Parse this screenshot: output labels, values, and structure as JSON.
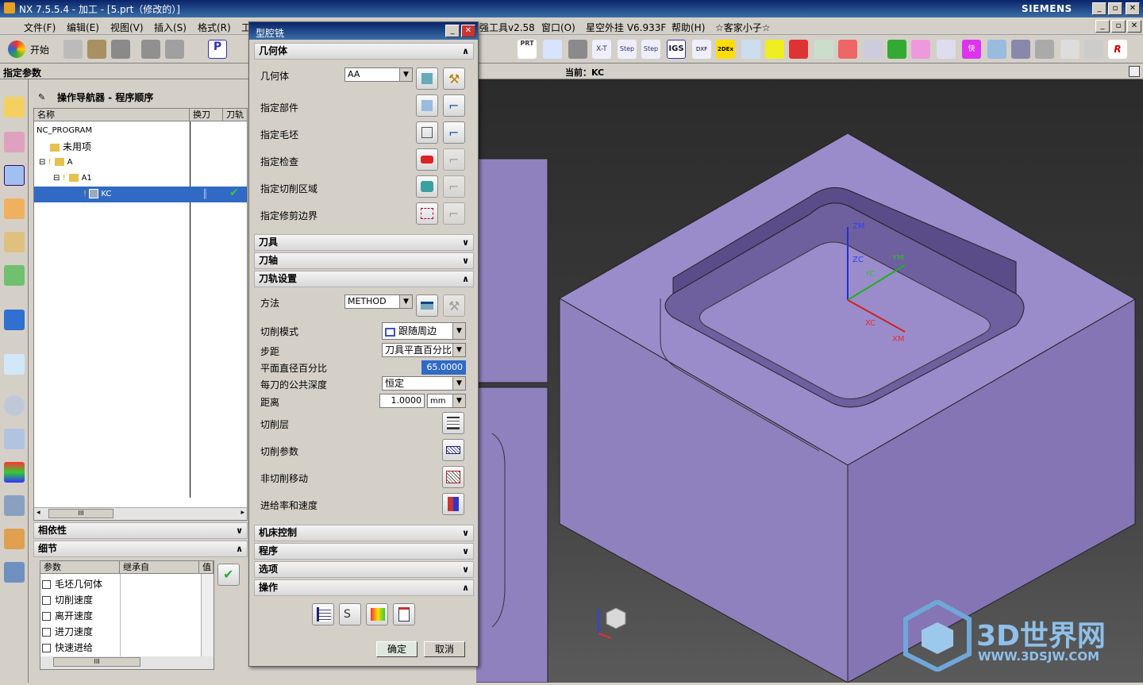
{
  "window": {
    "title": "NX 7.5.5.4 - 加工 - [5.prt（修改的）]",
    "brand": "SIEMENS"
  },
  "menu": [
    "文件(F)",
    "编辑(E)",
    "视图(V)",
    "插入(S)",
    "格式(R)",
    "工",
    "强工具v2.58",
    "窗口(O)",
    "星空外挂 V6.933F",
    "帮助(H)",
    "☆客家小子☆"
  ],
  "toolbar": {
    "start_label": "开始",
    "labels": [
      "PRT",
      "X-T",
      "Step",
      "Step",
      "IGS",
      "DXF",
      "2DEx"
    ]
  },
  "status": {
    "left": "指定参数",
    "current": "当前：KC"
  },
  "navigator": {
    "title": "操作导航器 - 程序顺序",
    "columns": [
      "名称",
      "换刀",
      "刀轨"
    ],
    "rows": [
      {
        "name": "NC_PROGRAM",
        "indent": 0
      },
      {
        "name": "未用项",
        "indent": 1
      },
      {
        "name": "A",
        "indent": 1
      },
      {
        "name": "A1",
        "indent": 2
      },
      {
        "name": "KC",
        "indent": 3,
        "selected": true
      }
    ],
    "scroll_label": "III"
  },
  "dependency": {
    "title": "相依性"
  },
  "details": {
    "title": "细节",
    "columns": [
      "参数",
      "继承自",
      "值"
    ],
    "params": [
      "毛坯几何体",
      "切削速度",
      "离开速度",
      "进刀速度",
      "快速进给"
    ],
    "scroll_label": "III"
  },
  "dialog": {
    "title": "型腔铣",
    "sec_geometry": "几何体",
    "geometry_label": "几何体",
    "geometry_value": "AA",
    "geo_items": [
      "指定部件",
      "指定毛坯",
      "指定检查",
      "指定切削区域",
      "指定修剪边界"
    ],
    "sec_tool": "刀具",
    "sec_axis": "刀轴",
    "sec_path": "刀轨设置",
    "method_label": "方法",
    "method_value": "METHOD",
    "cut_mode_label": "切削模式",
    "cut_mode_value": "跟随周边",
    "stepover_label": "步距",
    "stepover_value": "刀具平直百分比",
    "percent_label": "平面直径百分比",
    "percent_value": "65.0000",
    "depth_label": "每刀的公共深度",
    "depth_value": "恒定",
    "distance_label": "距离",
    "distance_value": "1.0000",
    "distance_unit": "mm",
    "btn_items": [
      "切削层",
      "切削参数",
      "非切削移动",
      "进给率和速度"
    ],
    "sec_machine": "机床控制",
    "sec_program": "程序",
    "sec_options": "选项",
    "sec_ops": "操作",
    "ok": "确定",
    "cancel": "取消"
  },
  "viewport": {
    "axis": {
      "zm": "ZM",
      "zc": "ZC",
      "ym": "YM",
      "yc": "YC",
      "xc": "XC",
      "xm": "XM"
    },
    "watermark": "3D世界网",
    "watermark_url": "WWW.3DSJW.COM",
    "colors": {
      "part": "#8f81be",
      "part_top": "#9a8ccb"
    }
  }
}
